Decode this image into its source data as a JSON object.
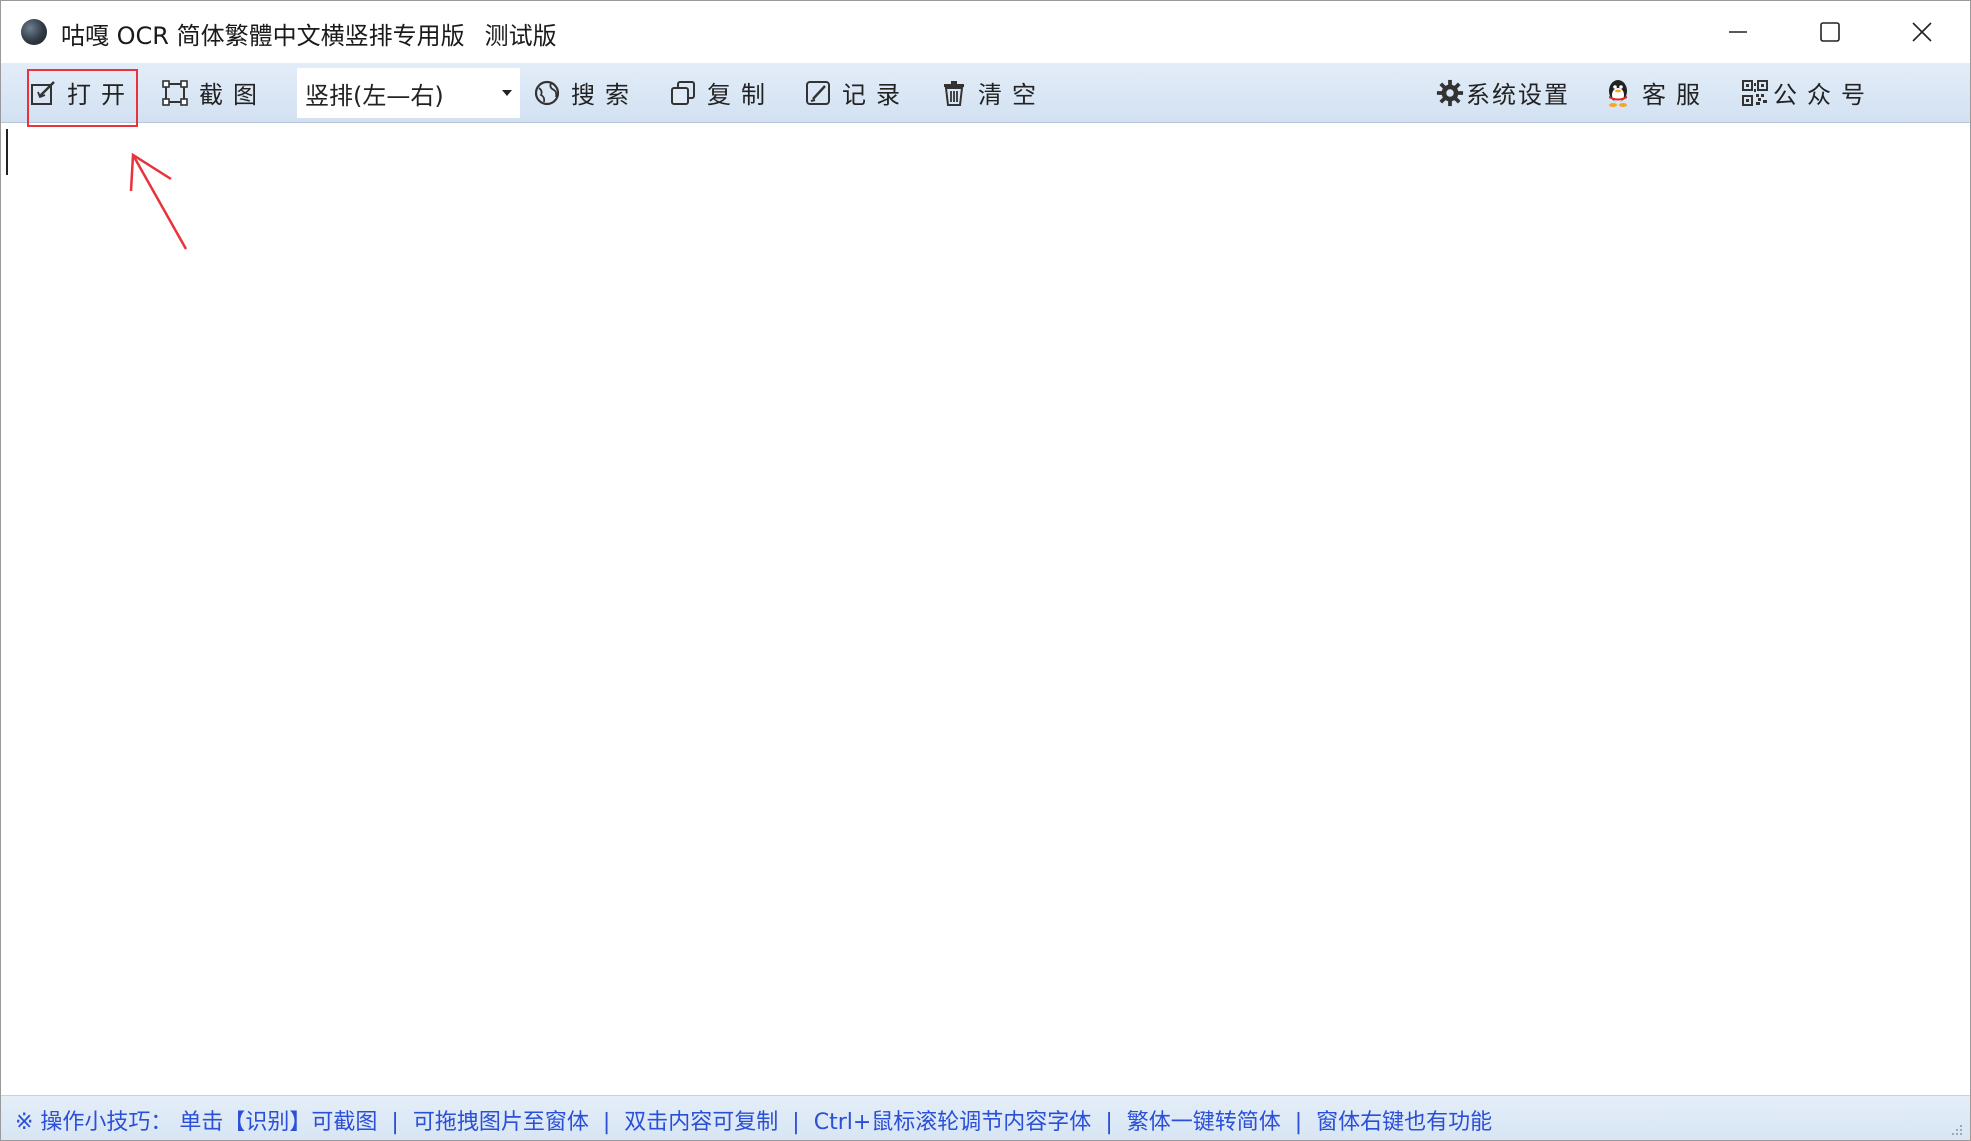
{
  "window": {
    "title": "咕嘎 OCR 简体繁體中文横竖排专用版",
    "version_label": "测试版",
    "controls": {
      "minimize": "minimize-icon",
      "maximize": "maximize-icon",
      "close": "close-icon"
    }
  },
  "toolbar": {
    "open_label": "打开",
    "screenshot_label": "截图",
    "orientation_select": {
      "selected": "竖排(左—右)"
    },
    "search_label": "搜索",
    "copy_label": "复制",
    "history_label": "记录",
    "clear_label": "清空",
    "settings_label": "系统设置",
    "support_label": "客服",
    "official_account_label": "公众号"
  },
  "annotation": {
    "highlight_color": "#e8323c"
  },
  "editor": {
    "content": ""
  },
  "statusbar": {
    "tips": [
      "※ 操作小技巧：  单击【识别】可截图",
      "可拖拽图片至窗体",
      "双击内容可复制",
      "Ctrl+鼠标滚轮调节内容字体",
      "繁体一键转简体",
      "窗体右键也有功能"
    ],
    "separator": "|",
    "tip_color": "#2b4fd6"
  }
}
